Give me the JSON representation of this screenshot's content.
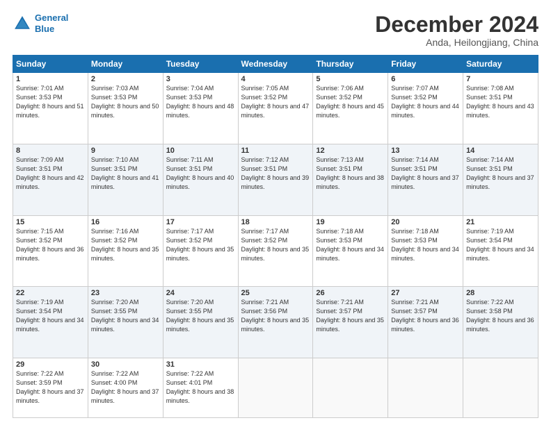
{
  "header": {
    "logo_line1": "General",
    "logo_line2": "Blue",
    "month": "December 2024",
    "location": "Anda, Heilongjiang, China"
  },
  "days_of_week": [
    "Sunday",
    "Monday",
    "Tuesday",
    "Wednesday",
    "Thursday",
    "Friday",
    "Saturday"
  ],
  "weeks": [
    [
      {
        "day": 1,
        "sunrise": "7:01 AM",
        "sunset": "3:53 PM",
        "daylight": "8 hours and 51 minutes."
      },
      {
        "day": 2,
        "sunrise": "7:03 AM",
        "sunset": "3:53 PM",
        "daylight": "8 hours and 50 minutes."
      },
      {
        "day": 3,
        "sunrise": "7:04 AM",
        "sunset": "3:53 PM",
        "daylight": "8 hours and 48 minutes."
      },
      {
        "day": 4,
        "sunrise": "7:05 AM",
        "sunset": "3:52 PM",
        "daylight": "8 hours and 47 minutes."
      },
      {
        "day": 5,
        "sunrise": "7:06 AM",
        "sunset": "3:52 PM",
        "daylight": "8 hours and 45 minutes."
      },
      {
        "day": 6,
        "sunrise": "7:07 AM",
        "sunset": "3:52 PM",
        "daylight": "8 hours and 44 minutes."
      },
      {
        "day": 7,
        "sunrise": "7:08 AM",
        "sunset": "3:51 PM",
        "daylight": "8 hours and 43 minutes."
      }
    ],
    [
      {
        "day": 8,
        "sunrise": "7:09 AM",
        "sunset": "3:51 PM",
        "daylight": "8 hours and 42 minutes."
      },
      {
        "day": 9,
        "sunrise": "7:10 AM",
        "sunset": "3:51 PM",
        "daylight": "8 hours and 41 minutes."
      },
      {
        "day": 10,
        "sunrise": "7:11 AM",
        "sunset": "3:51 PM",
        "daylight": "8 hours and 40 minutes."
      },
      {
        "day": 11,
        "sunrise": "7:12 AM",
        "sunset": "3:51 PM",
        "daylight": "8 hours and 39 minutes."
      },
      {
        "day": 12,
        "sunrise": "7:13 AM",
        "sunset": "3:51 PM",
        "daylight": "8 hours and 38 minutes."
      },
      {
        "day": 13,
        "sunrise": "7:14 AM",
        "sunset": "3:51 PM",
        "daylight": "8 hours and 37 minutes."
      },
      {
        "day": 14,
        "sunrise": "7:14 AM",
        "sunset": "3:51 PM",
        "daylight": "8 hours and 37 minutes."
      }
    ],
    [
      {
        "day": 15,
        "sunrise": "7:15 AM",
        "sunset": "3:52 PM",
        "daylight": "8 hours and 36 minutes."
      },
      {
        "day": 16,
        "sunrise": "7:16 AM",
        "sunset": "3:52 PM",
        "daylight": "8 hours and 35 minutes."
      },
      {
        "day": 17,
        "sunrise": "7:17 AM",
        "sunset": "3:52 PM",
        "daylight": "8 hours and 35 minutes."
      },
      {
        "day": 18,
        "sunrise": "7:17 AM",
        "sunset": "3:52 PM",
        "daylight": "8 hours and 35 minutes."
      },
      {
        "day": 19,
        "sunrise": "7:18 AM",
        "sunset": "3:53 PM",
        "daylight": "8 hours and 34 minutes."
      },
      {
        "day": 20,
        "sunrise": "7:18 AM",
        "sunset": "3:53 PM",
        "daylight": "8 hours and 34 minutes."
      },
      {
        "day": 21,
        "sunrise": "7:19 AM",
        "sunset": "3:54 PM",
        "daylight": "8 hours and 34 minutes."
      }
    ],
    [
      {
        "day": 22,
        "sunrise": "7:19 AM",
        "sunset": "3:54 PM",
        "daylight": "8 hours and 34 minutes."
      },
      {
        "day": 23,
        "sunrise": "7:20 AM",
        "sunset": "3:55 PM",
        "daylight": "8 hours and 34 minutes."
      },
      {
        "day": 24,
        "sunrise": "7:20 AM",
        "sunset": "3:55 PM",
        "daylight": "8 hours and 35 minutes."
      },
      {
        "day": 25,
        "sunrise": "7:21 AM",
        "sunset": "3:56 PM",
        "daylight": "8 hours and 35 minutes."
      },
      {
        "day": 26,
        "sunrise": "7:21 AM",
        "sunset": "3:57 PM",
        "daylight": "8 hours and 35 minutes."
      },
      {
        "day": 27,
        "sunrise": "7:21 AM",
        "sunset": "3:57 PM",
        "daylight": "8 hours and 36 minutes."
      },
      {
        "day": 28,
        "sunrise": "7:22 AM",
        "sunset": "3:58 PM",
        "daylight": "8 hours and 36 minutes."
      }
    ],
    [
      {
        "day": 29,
        "sunrise": "7:22 AM",
        "sunset": "3:59 PM",
        "daylight": "8 hours and 37 minutes."
      },
      {
        "day": 30,
        "sunrise": "7:22 AM",
        "sunset": "4:00 PM",
        "daylight": "8 hours and 37 minutes."
      },
      {
        "day": 31,
        "sunrise": "7:22 AM",
        "sunset": "4:01 PM",
        "daylight": "8 hours and 38 minutes."
      },
      null,
      null,
      null,
      null
    ]
  ]
}
